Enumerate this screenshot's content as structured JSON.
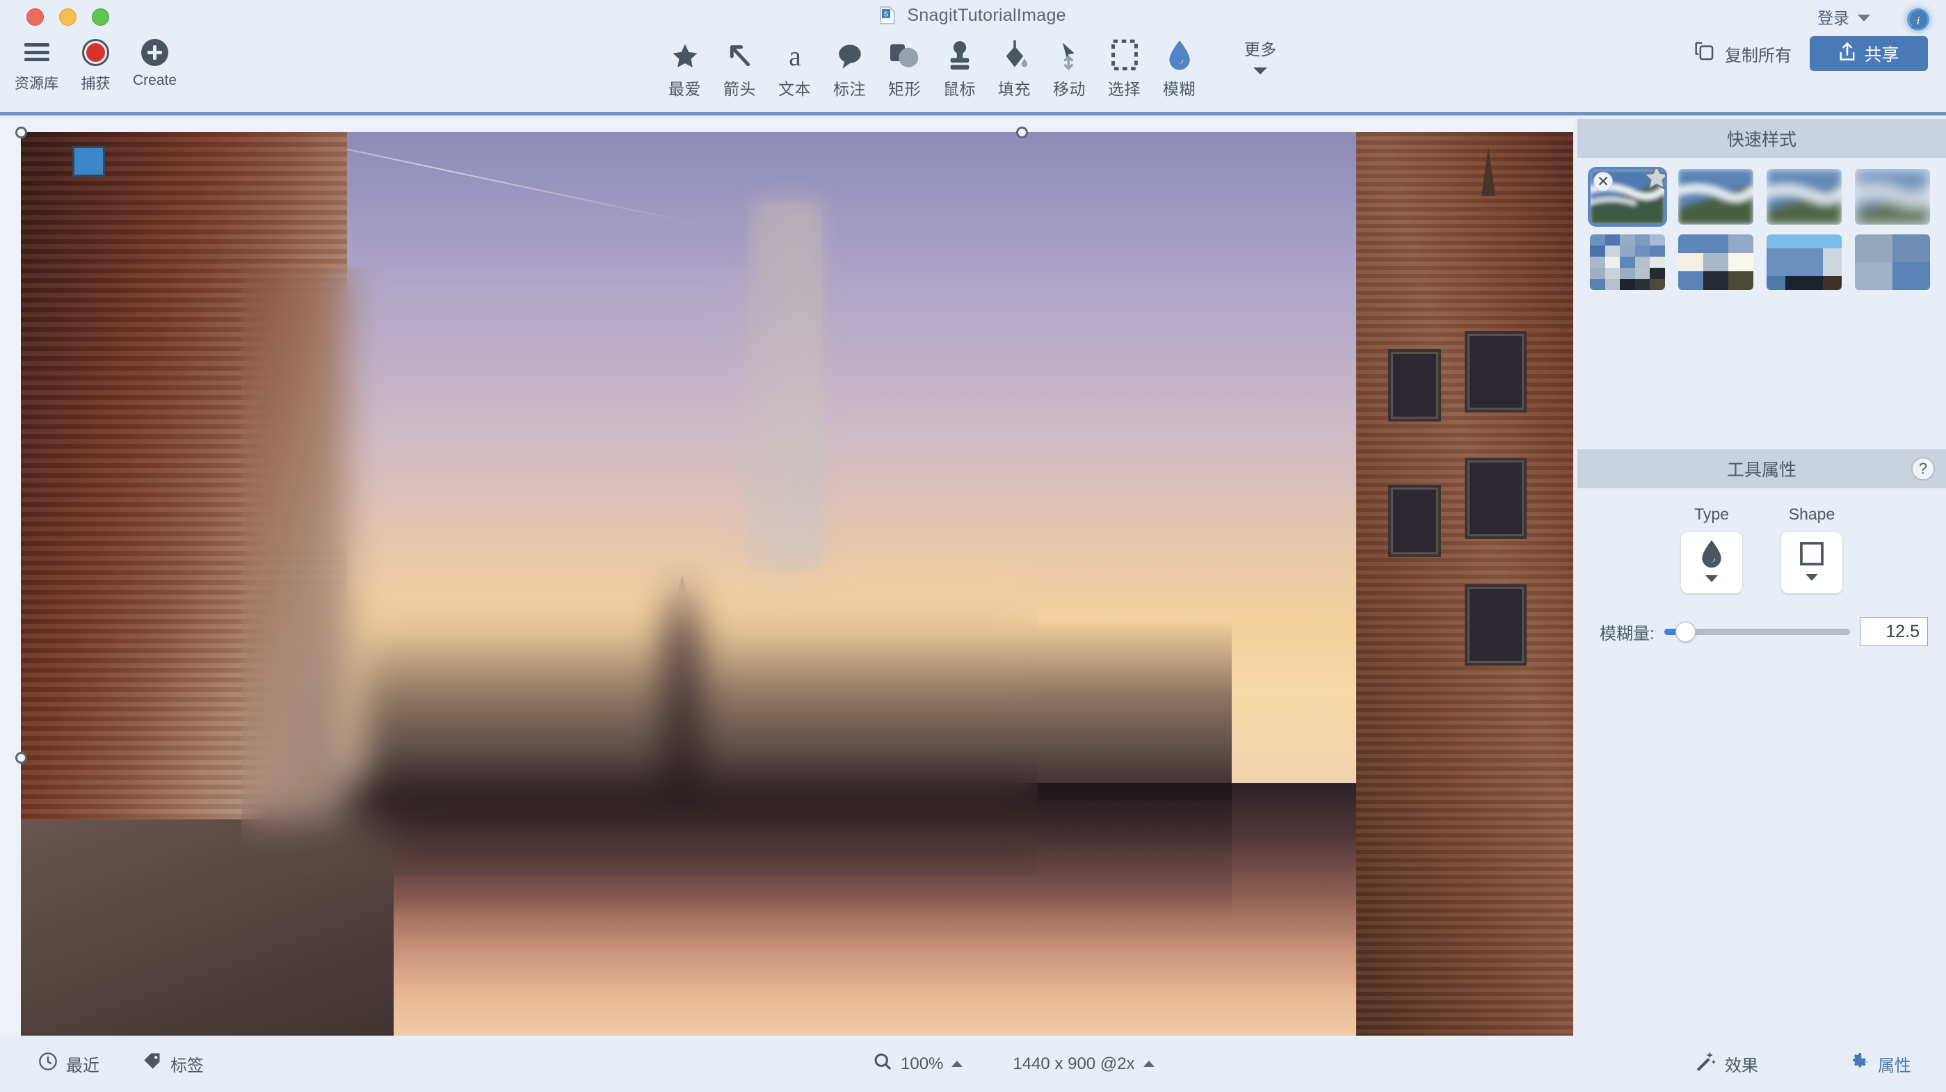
{
  "window": {
    "title": "SnagitTutorialImage",
    "doc_icon": "snagit-document-icon",
    "traffic_lights": [
      "close",
      "minimize",
      "zoom"
    ]
  },
  "toolbar_left": [
    {
      "label": "资源库",
      "icon": "hamburger-icon"
    },
    {
      "label": "捕获",
      "icon": "record-icon"
    },
    {
      "label": "Create",
      "icon": "plus-circle-icon"
    }
  ],
  "toolbar_center": {
    "tools": [
      {
        "label": "最爱",
        "icon": "star-icon",
        "active": false
      },
      {
        "label": "箭头",
        "icon": "arrow-icon",
        "active": false
      },
      {
        "label": "文本",
        "icon": "text-a-icon",
        "active": false
      },
      {
        "label": "标注",
        "icon": "callout-bubble-icon",
        "active": false
      },
      {
        "label": "矩形",
        "icon": "shapes-icon",
        "active": false
      },
      {
        "label": "鼠标",
        "icon": "stamp-icon",
        "active": false
      },
      {
        "label": "填充",
        "icon": "fill-bucket-icon",
        "active": false
      },
      {
        "label": "移动",
        "icon": "move-icon",
        "active": false
      },
      {
        "label": "选择",
        "icon": "selection-marquee-icon",
        "active": false
      },
      {
        "label": "模糊",
        "icon": "blur-droplet-icon",
        "active": true
      }
    ],
    "more_label": "更多"
  },
  "toolbar_right": {
    "signin_label": "登录",
    "info_icon": "info-badge-icon",
    "copy_all_label": "复制所有",
    "copy_all_icon": "copy-icon",
    "share_label": "共享",
    "share_icon": "share-upload-icon",
    "share_color": "#4a7ab5"
  },
  "canvas": {
    "image_description": "Bruges canal at sunset with brick buildings",
    "blur_overlay_applied": true,
    "handles": [
      "top-left",
      "top-center",
      "left-middle"
    ]
  },
  "quick_styles": {
    "title": "快速样式",
    "items": [
      {
        "index": 1,
        "type": "blur-preview",
        "selected": true,
        "delete_badge": "✕",
        "favorite_badge": "star-icon"
      },
      {
        "index": 2,
        "type": "blur-preview",
        "selected": false
      },
      {
        "index": 3,
        "type": "blur-preview",
        "selected": false
      },
      {
        "index": 4,
        "type": "blur-preview",
        "selected": false
      },
      {
        "index": 5,
        "type": "pixelate-preview",
        "selected": false
      },
      {
        "index": 6,
        "type": "pixelate-preview",
        "selected": false
      },
      {
        "index": 7,
        "type": "pixelate-preview",
        "selected": false
      },
      {
        "index": 8,
        "type": "pixelate-preview",
        "selected": false
      }
    ]
  },
  "tool_properties": {
    "title": "工具属性",
    "help_label": "?",
    "type_caption": "Type",
    "type_icon": "droplet-icon",
    "shape_caption": "Shape",
    "shape_icon": "square-icon",
    "blur_amount_label": "模糊量:",
    "blur_amount_value": "12.5",
    "slider_percent": 8,
    "accent_color": "#3f7fe0"
  },
  "statusbar": {
    "recent_label": "最近",
    "recent_icon": "clock-icon",
    "tags_label": "标签",
    "tags_icon": "tag-icon",
    "zoom_icon": "search-icon",
    "zoom_value": "100%",
    "dimensions": "1440 x 900 @2x",
    "effects_label": "效果",
    "effects_icon": "magic-wand-icon",
    "properties_label": "属性",
    "properties_icon": "gear-icon",
    "properties_active": true,
    "active_color": "#4a7ab5"
  }
}
